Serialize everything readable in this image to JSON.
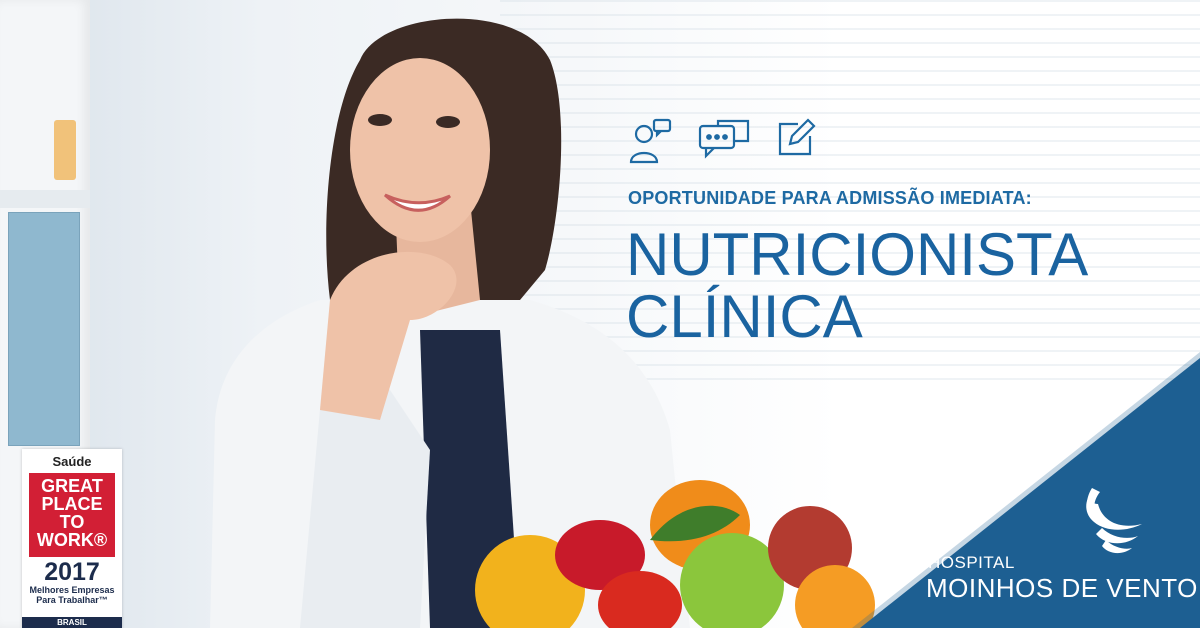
{
  "colors": {
    "primary_blue": "#1a63a0",
    "triangle_blue": "#1d5f92",
    "badge_red": "#d21f35",
    "badge_navy": "#1c2c4c"
  },
  "icons": [
    "user-chat-icon",
    "chat-bubbles-icon",
    "edit-note-icon"
  ],
  "headline": {
    "subtitle": "OPORTUNIDADE PARA ADMISSÃO IMEDIATA:",
    "title_line1": "NUTRICIONISTA",
    "title_line2": "CLÍNICA"
  },
  "logo": {
    "small": "HOSPITAL",
    "big": "MOINHOS DE VENTO"
  },
  "badge": {
    "sector": "Saúde",
    "line1": "GREAT",
    "line2": "PLACE",
    "line3": "TO",
    "line4": "WORK®",
    "year": "2017",
    "caption1": "Melhores Empresas",
    "caption2": "Para Trabalhar™",
    "country": "BRASIL"
  }
}
